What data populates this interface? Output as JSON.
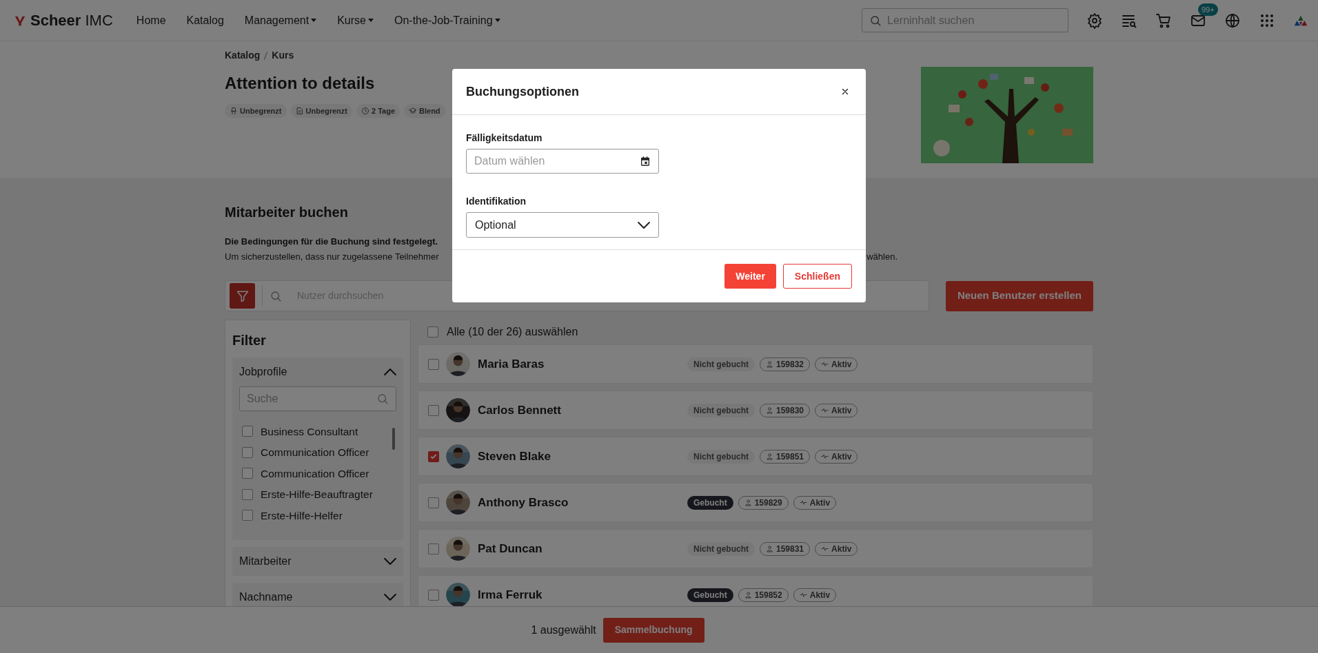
{
  "header": {
    "logo": "**Scheer** IMC",
    "nav": [
      {
        "label": "Home",
        "dropdown": false
      },
      {
        "label": "Katalog",
        "dropdown": false
      },
      {
        "label": "Management",
        "dropdown": true
      },
      {
        "label": "Kurse",
        "dropdown": true
      },
      {
        "label": "On-the-Job-Training",
        "dropdown": true
      }
    ],
    "search": {
      "placeholder": "Lerninhalt suchen"
    },
    "mail_badge": "99+"
  },
  "breadcrumb": [
    "Katalog",
    "Kurs"
  ],
  "course": {
    "title": "Attention to details",
    "chips": [
      {
        "kind": "seat",
        "label": "Unbegrenzt"
      },
      {
        "kind": "doc",
        "label": "Unbegrenzt"
      },
      {
        "kind": "clock",
        "label": "2 Tage"
      },
      {
        "kind": "cap",
        "label": "Blend"
      }
    ]
  },
  "booking": {
    "title": "Mitarbeiter buchen",
    "conditions_bold": "Die Bedingungen für die Buchung sind festgelegt.",
    "conditions_start": "Um sicherzustellen, dass nur zugelassene Teilnehmer",
    "conditions_end": "wählen.",
    "search": {
      "placeholder": "Nutzer durchsuchen"
    },
    "create_button": "Neuen Benutzer erstellen"
  },
  "filter": {
    "title": "Filter",
    "sections": [
      {
        "label": "Jobprofile",
        "expanded": true,
        "search_placeholder": "Suche",
        "options": [
          {
            "label": "Business Consultant",
            "checked": false
          },
          {
            "label": "Communication Officer",
            "checked": false
          },
          {
            "label": "Communication Officer",
            "checked": false
          },
          {
            "label": "Erste-Hilfe-Beauftragter",
            "checked": false
          },
          {
            "label": "Erste-Hilfe-Helfer",
            "checked": false
          }
        ]
      },
      {
        "label": "Mitarbeiter",
        "expanded": false
      },
      {
        "label": "Nachname",
        "expanded": false
      }
    ]
  },
  "select_all": {
    "label": "Alle (10 der 26) auswählen",
    "checked": false
  },
  "users": [
    {
      "name": "Maria Baras",
      "checked": false,
      "booked": false,
      "status_label": "Nicht gebucht",
      "id": "159832",
      "state": "Aktiv"
    },
    {
      "name": "Carlos Bennett",
      "checked": false,
      "booked": false,
      "status_label": "Nicht gebucht",
      "id": "159830",
      "state": "Aktiv"
    },
    {
      "name": "Steven Blake",
      "checked": true,
      "booked": false,
      "status_label": "Nicht gebucht",
      "id": "159851",
      "state": "Aktiv"
    },
    {
      "name": "Anthony Brasco",
      "checked": false,
      "booked": true,
      "status_label": "Gebucht",
      "id": "159829",
      "state": "Aktiv"
    },
    {
      "name": "Pat Duncan",
      "checked": false,
      "booked": false,
      "status_label": "Nicht gebucht",
      "id": "159831",
      "state": "Aktiv"
    },
    {
      "name": "Irma Ferruk",
      "checked": false,
      "booked": true,
      "status_label": "Gebucht",
      "id": "159852",
      "state": "Aktiv"
    }
  ],
  "bottom_bar": {
    "selected_text": "1 ausgewählt",
    "button": "Sammelbuchung"
  },
  "modal": {
    "title": "Buchungsoptionen",
    "fields": [
      {
        "kind": "date",
        "label": "Fälligkeitsdatum",
        "placeholder": "Datum wählen"
      },
      {
        "kind": "select",
        "label": "Identifikation",
        "value": "Optional"
      }
    ],
    "buttons": [
      {
        "kind": "primary",
        "label": "Weiter"
      },
      {
        "kind": "secondary",
        "label": "Schließen"
      }
    ]
  }
}
